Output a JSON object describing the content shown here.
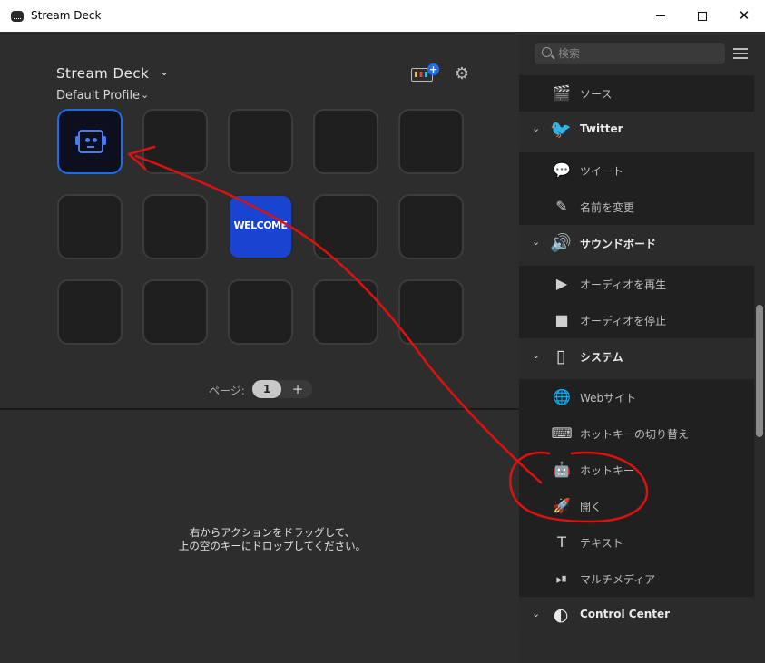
{
  "window": {
    "title": "Stream Deck",
    "controls": {
      "minimize": "",
      "maximize": "",
      "close": "✕"
    }
  },
  "left": {
    "device_name": "Stream Deck",
    "profile_name": "Default Profile",
    "keys": [
      {
        "content": "hotkey-robot",
        "selected": true
      },
      {
        "content": ""
      },
      {
        "content": ""
      },
      {
        "content": ""
      },
      {
        "content": ""
      },
      {
        "content": ""
      },
      {
        "content": ""
      },
      {
        "content": "welcome",
        "label": "WELCOME"
      },
      {
        "content": ""
      },
      {
        "content": ""
      },
      {
        "content": ""
      },
      {
        "content": ""
      },
      {
        "content": ""
      },
      {
        "content": ""
      },
      {
        "content": ""
      }
    ],
    "pager": {
      "label": "ページ:",
      "current": "1",
      "add": "+"
    },
    "hint_line1": "右からアクションをドラッグして、",
    "hint_line2": "上の空のキーにドロップしてください。"
  },
  "sidebar": {
    "search_placeholder": "検索",
    "items": [
      {
        "type": "item",
        "icon": "clapper-icon",
        "glyph": "🎬",
        "label": "ソース"
      },
      {
        "type": "category",
        "icon": "twitter-icon",
        "glyph": "🐦",
        "label": "Twitter"
      },
      {
        "type": "item",
        "icon": "tweet-icon",
        "glyph": "💬",
        "label": "ツイート"
      },
      {
        "type": "item",
        "icon": "rename-icon",
        "glyph": "✎",
        "label": "名前を変更"
      },
      {
        "type": "category",
        "icon": "speaker-icon",
        "glyph": "🔊",
        "label": "サウンドボード"
      },
      {
        "type": "item",
        "icon": "play-icon",
        "glyph": "▶",
        "label": "オーディオを再生"
      },
      {
        "type": "item",
        "icon": "stop-icon",
        "glyph": "■",
        "label": "オーディオを停止"
      },
      {
        "type": "category",
        "icon": "system-icon",
        "glyph": "▯",
        "label": "システム"
      },
      {
        "type": "item",
        "icon": "globe-icon",
        "glyph": "🌐",
        "label": "Webサイト"
      },
      {
        "type": "item",
        "icon": "hotkey-switch-icon",
        "glyph": "⌨",
        "label": "ホットキーの切り替え"
      },
      {
        "type": "item",
        "icon": "hotkey-icon",
        "glyph": "🤖",
        "label": "ホットキー"
      },
      {
        "type": "item",
        "icon": "open-icon",
        "glyph": "🚀",
        "label": "開く"
      },
      {
        "type": "item",
        "icon": "text-icon",
        "glyph": "T",
        "label": "テキスト"
      },
      {
        "type": "item",
        "icon": "multimedia-icon",
        "glyph": "⏯",
        "label": "マルチメディア"
      },
      {
        "type": "category",
        "icon": "control-center-icon",
        "glyph": "◐",
        "label": "Control Center"
      }
    ]
  },
  "colors": {
    "accent": "#1a6cf0",
    "welcome_key": "#1844d0",
    "annotation_red": "#e01010"
  }
}
